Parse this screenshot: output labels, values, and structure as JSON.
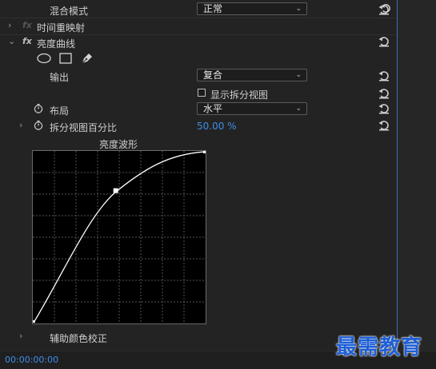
{
  "rows": {
    "blend_mode": {
      "label": "混合模式",
      "value": "正常"
    },
    "time_remap": {
      "label": "时间重映射"
    },
    "luma_curve": {
      "label": "亮度曲线"
    },
    "output": {
      "label": "输出",
      "value": "复合"
    },
    "split_view": {
      "label": "显示拆分视图"
    },
    "layout": {
      "label": "布局",
      "value": "水平"
    },
    "split_percent": {
      "label": "拆分视图百分比",
      "value": "50.00 %"
    },
    "aux_color": {
      "label": "辅助颜色校正"
    }
  },
  "waveform": {
    "title": "亮度波形",
    "curve_control_point": {
      "input": 0.48,
      "output": 0.77
    }
  },
  "footer": {
    "timecode": "00:00:00:00"
  },
  "watermark": "最需教育",
  "icons": {
    "expand": "chevron-right-icon",
    "collapse": "chevron-down-icon",
    "fx": "fx-icon",
    "reset": "reset-icon",
    "stopwatch": "stopwatch-icon",
    "ellipse_tool": "ellipse-mask-icon",
    "rect_tool": "rectangle-mask-icon",
    "pen_tool": "pen-mask-icon"
  },
  "colors": {
    "accent": "#3d8ee8",
    "panel_bg": "#232323",
    "graph_bg": "#000000"
  }
}
